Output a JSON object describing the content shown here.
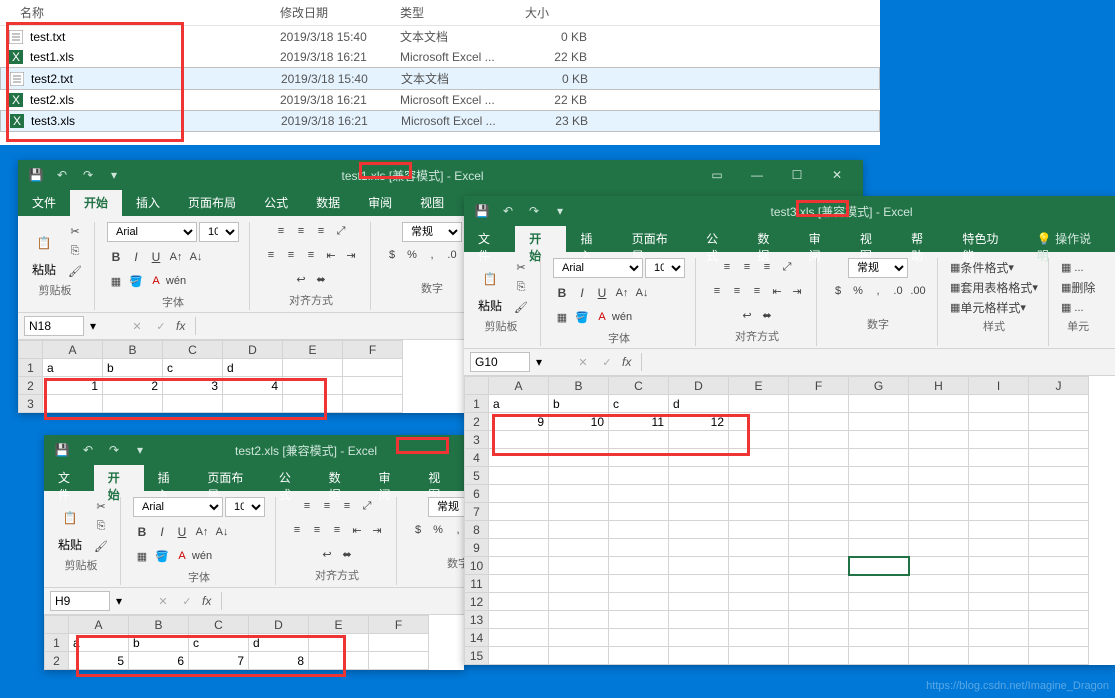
{
  "explorer": {
    "headers": {
      "name": "名称",
      "date": "修改日期",
      "type": "类型",
      "size": "大小"
    },
    "rows": [
      {
        "name": "test.txt",
        "date": "2019/3/18 15:40",
        "type": "文本文档",
        "size": "0 KB",
        "icon": "txt"
      },
      {
        "name": "test1.xls",
        "date": "2019/3/18 16:21",
        "type": "Microsoft Excel ...",
        "size": "22 KB",
        "icon": "xls"
      },
      {
        "name": "test2.txt",
        "date": "2019/3/18 15:40",
        "type": "文本文档",
        "size": "0 KB",
        "icon": "txt",
        "sel": true
      },
      {
        "name": "test2.xls",
        "date": "2019/3/18 16:21",
        "type": "Microsoft Excel ...",
        "size": "22 KB",
        "icon": "xls"
      },
      {
        "name": "test3.xls",
        "date": "2019/3/18 16:21",
        "type": "Microsoft Excel ...",
        "size": "23 KB",
        "icon": "xls",
        "sel": true
      }
    ]
  },
  "excel_common": {
    "mode": "[兼容模式]",
    "app": "Excel",
    "tabs": {
      "file": "文件",
      "home": "开始",
      "insert": "插入",
      "layout": "页面布局",
      "formula": "公式",
      "data": "数据",
      "review": "审阅",
      "view": "视图",
      "help": "帮助",
      "special": "特色功能",
      "tell": "操作说明"
    },
    "groups": {
      "clipboard": "剪贴板",
      "font": "字体",
      "align": "对齐方式",
      "number": "数字",
      "styles": "样式",
      "cells": "单元"
    },
    "paste": "粘贴",
    "font_name": "Arial",
    "font_size": "10",
    "normal": "常规",
    "style_items": {
      "cond": "条件格式",
      "tablefmt": "套用表格格式",
      "cellstyle": "单元格样式"
    },
    "cell_items": {
      "delete": "删除"
    }
  },
  "win1": {
    "file": "test1.xls",
    "cell": "N18",
    "data": {
      "h": [
        "a",
        "b",
        "c",
        "d"
      ],
      "v": [
        "1",
        "2",
        "3",
        "4"
      ]
    }
  },
  "win2": {
    "file": "test2.xls",
    "cell": "H9",
    "data": {
      "h": [
        "a",
        "b",
        "c",
        "d"
      ],
      "v": [
        "5",
        "6",
        "7",
        "8"
      ]
    }
  },
  "win3": {
    "file": "test3.xls",
    "cell": "G10",
    "data": {
      "h": [
        "a",
        "b",
        "c",
        "d"
      ],
      "v": [
        "9",
        "10",
        "11",
        "12"
      ]
    }
  },
  "watermark": "https://blog.csdn.net/Imagine_Dragon"
}
